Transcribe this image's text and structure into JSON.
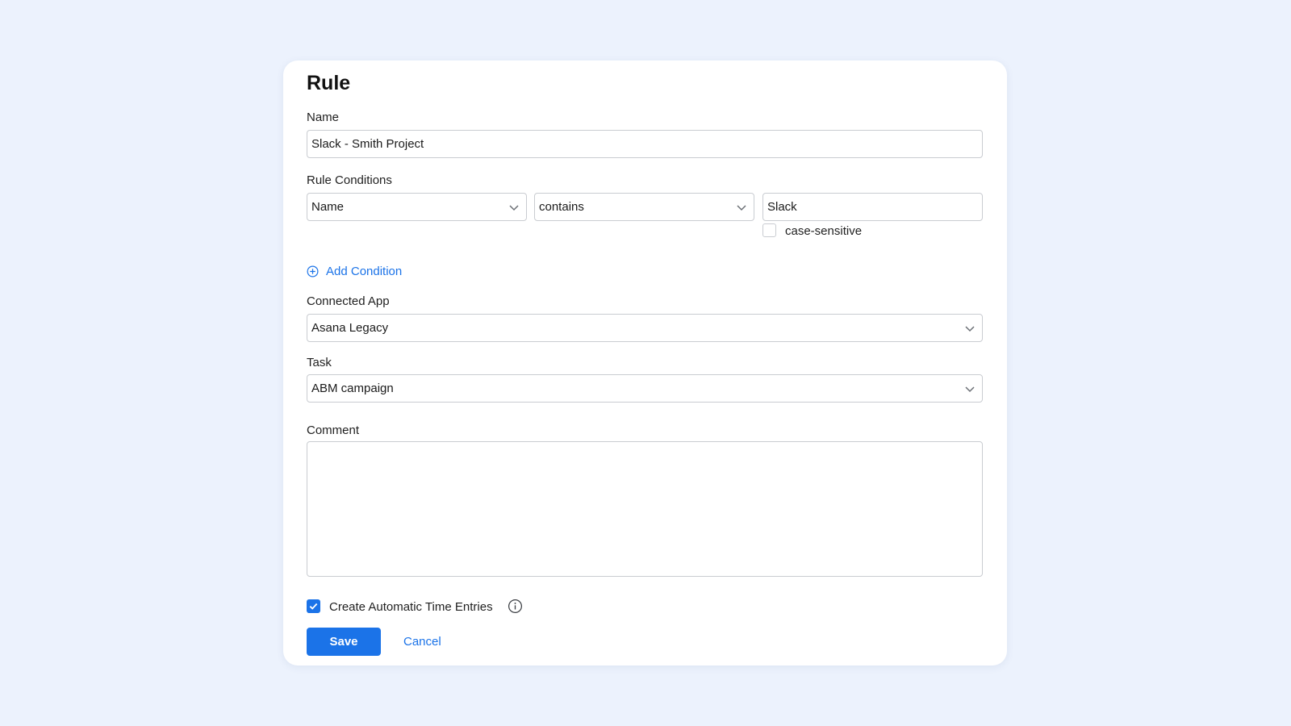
{
  "form": {
    "title": "Rule",
    "name_label": "Name",
    "name_value": "Slack - Smith Project",
    "conditions_label": "Rule Conditions",
    "condition": {
      "field": "Name",
      "operator": "contains",
      "value": "Slack",
      "case_sensitive_label": "case-sensitive",
      "case_sensitive": false
    },
    "add_condition_label": "Add Condition",
    "connected_app_label": "Connected App",
    "connected_app_value": "Asana Legacy",
    "task_label": "Task",
    "task_value": "ABM campaign",
    "comment_label": "Comment",
    "comment_value": "",
    "auto_entries_label": "Create Automatic Time Entries",
    "auto_entries_checked": true,
    "save_label": "Save",
    "cancel_label": "Cancel"
  },
  "colors": {
    "accent": "#1b73e8",
    "page_bg": "#ecf2fd",
    "card_bg": "#ffffff",
    "border": "#c9ccd1"
  },
  "icons": {
    "dropdown": "chevron-down-icon",
    "add": "plus-circle-icon",
    "info": "info-icon",
    "check": "check-icon"
  }
}
